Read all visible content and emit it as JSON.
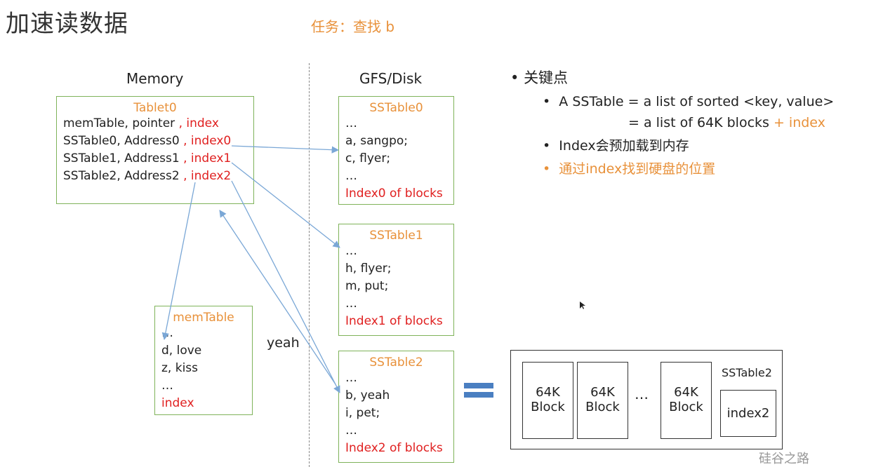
{
  "slide": {
    "title": "加速读数据",
    "task": "任务：查找 b",
    "watermark": "硅谷之路"
  },
  "columns": {
    "memory": "Memory",
    "disk": "GFS/Disk"
  },
  "tablet0": {
    "header": "Tablet0",
    "rows": [
      {
        "text": "memTable, pointer ",
        "red": ", index"
      },
      {
        "text": "SSTable0, Address0 ",
        "red": ", index0"
      },
      {
        "text": "SSTable1, Address1 ",
        "red": ", index1"
      },
      {
        "text": "SSTable2, Address2 ",
        "red": ", index2"
      }
    ]
  },
  "memtable": {
    "header": "memTable",
    "lines": [
      "…",
      "d, love",
      "z, kiss",
      "…"
    ],
    "index": "index"
  },
  "sstable0": {
    "header": "SSTable0",
    "lines": [
      "…",
      "a, sangpo;",
      "c, flyer;",
      "…"
    ],
    "index": "Index0 of blocks"
  },
  "sstable1": {
    "header": "SSTable1",
    "lines": [
      "…",
      "h, flyer;",
      "m, put;",
      "…"
    ],
    "index": "Index1 of blocks"
  },
  "sstable2": {
    "header": "SSTable2",
    "lines": [
      "…",
      "b, yeah",
      "i, pet;",
      "…"
    ],
    "index": "Index2 of blocks"
  },
  "yeah_label": "yeah",
  "key_points": {
    "heading": "关键点",
    "items": [
      {
        "line1": "A SSTable = a list of sorted <key, value>",
        "line2_text": "= a list of 64K blocks ",
        "line2_orange": "+ index"
      },
      {
        "text": "Index会预加载到内存"
      },
      {
        "text": "通过index找到硬盘的位置",
        "orange": true
      }
    ]
  },
  "sstable2_detail": {
    "label": "SSTable2",
    "blocks": [
      {
        "line1": "64K",
        "line2": "Block"
      },
      {
        "line1": "64K",
        "line2": "Block"
      },
      {
        "line1": "64K",
        "line2": "Block"
      }
    ],
    "ellipsis": "…",
    "index": "index2"
  },
  "colors": {
    "box_border": "#7fb35a",
    "orange": "#e8913a",
    "red": "#e02020",
    "arrow": "#7aa7d6",
    "equals": "#4a7fc1"
  }
}
